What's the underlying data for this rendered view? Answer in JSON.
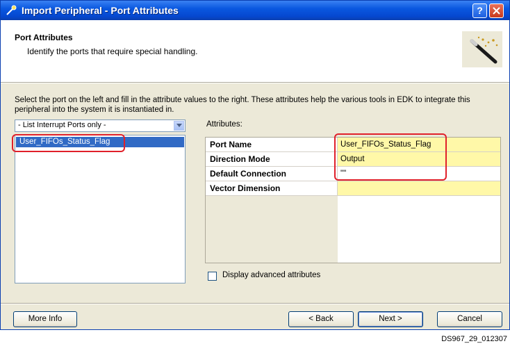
{
  "window": {
    "title": "Import Peripheral - Port Attributes"
  },
  "header": {
    "title": "Port Attributes",
    "subtitle": "Identify the ports that require special handling."
  },
  "instructions": "Select the port on the left and fill in the attribute values to the right. These attributes help the various tools in EDK to integrate this peripheral into the system it is instantiated in.",
  "port_filter": {
    "selected": "- List Interrupt Ports only -"
  },
  "ports": [
    {
      "name": "User_FIFOs_Status_Flag",
      "selected": true
    }
  ],
  "attributes": {
    "label": "Attributes:",
    "rows": [
      {
        "name": "Port Name",
        "value": "User_FIFOs_Status_Flag"
      },
      {
        "name": "Direction Mode",
        "value": "Output"
      },
      {
        "name": "Default Connection",
        "value": "\"\""
      },
      {
        "name": "Vector Dimension",
        "value": ""
      }
    ]
  },
  "advanced": {
    "label": "Display advanced attributes",
    "checked": false
  },
  "buttons": {
    "more_info": "More Info",
    "back": "< Back",
    "next": "Next >",
    "cancel": "Cancel"
  },
  "caption": "DS967_29_012307",
  "colors": {
    "titlebar": "#0a58e0",
    "highlight": "#e0202a",
    "selected_row": "#316ac5",
    "required_cell": "#fff8a8"
  }
}
